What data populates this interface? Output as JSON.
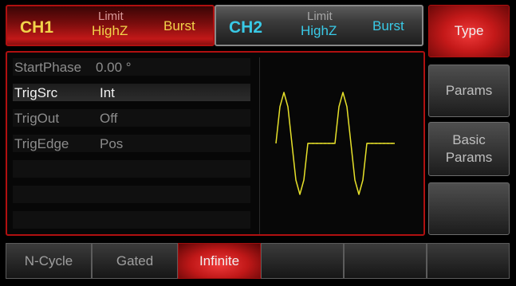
{
  "ch1": {
    "name": "CH1",
    "limit_label": "Limit",
    "impedance": "HighZ",
    "mode": "Burst"
  },
  "ch2": {
    "name": "CH2",
    "limit_label": "Limit",
    "impedance": "HighZ",
    "mode": "Burst"
  },
  "params": [
    {
      "key": "StartPhase",
      "value": "0.00 °",
      "selected": false
    },
    {
      "key": "TrigSrc",
      "value": "Int",
      "selected": true
    },
    {
      "key": "TrigOut",
      "value": "Off",
      "selected": false
    },
    {
      "key": "TrigEdge",
      "value": "Pos",
      "selected": false
    },
    {
      "key": "",
      "value": "",
      "selected": false
    },
    {
      "key": "",
      "value": "",
      "selected": false
    },
    {
      "key": "",
      "value": "",
      "selected": false
    }
  ],
  "softkeys": [
    {
      "label": "Type",
      "active": true
    },
    {
      "label": "Params",
      "active": false
    },
    {
      "label": "Basic\nParams",
      "active": false
    },
    {
      "label": "",
      "active": false
    }
  ],
  "bottom_tabs": [
    {
      "label": "N-Cycle",
      "active": false
    },
    {
      "label": "Gated",
      "active": false
    },
    {
      "label": "Infinite",
      "active": true
    },
    {
      "label": "",
      "active": false
    },
    {
      "label": "",
      "active": false
    },
    {
      "label": "",
      "active": false
    }
  ],
  "colors": {
    "accent_red": "#c21818",
    "ch1_yellow": "#f1d34a",
    "ch2_cyan": "#39c9e6",
    "wave": "#e6e02a"
  }
}
